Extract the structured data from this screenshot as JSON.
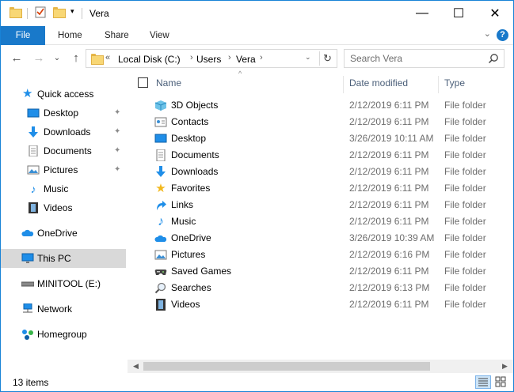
{
  "window": {
    "title": "Vera",
    "controls": {
      "minimize": "—",
      "maximize": "☐",
      "close": "✕"
    }
  },
  "ribbon": {
    "tabs": [
      "File",
      "Home",
      "Share",
      "View"
    ],
    "expand": "⌄",
    "help": "?"
  },
  "address": {
    "overflow": "«",
    "crumbs": [
      "Local Disk (C:)",
      "Users",
      "Vera"
    ],
    "separator": "›",
    "dropdown": "⌄",
    "refresh": "↻"
  },
  "search": {
    "placeholder": "Search Vera"
  },
  "nav_buttons": {
    "back": "←",
    "forward": "→",
    "recent": "⌄",
    "up": "↑"
  },
  "navigation": {
    "pin_glyph": "✦",
    "quick_access": {
      "label": "Quick access",
      "items": [
        {
          "label": "Desktop",
          "icon": "desktop-icon",
          "pinned": true
        },
        {
          "label": "Downloads",
          "icon": "downloads-icon",
          "pinned": true
        },
        {
          "label": "Documents",
          "icon": "documents-icon",
          "pinned": true
        },
        {
          "label": "Pictures",
          "icon": "pictures-icon",
          "pinned": true
        },
        {
          "label": "Music",
          "icon": "music-icon",
          "pinned": false
        },
        {
          "label": "Videos",
          "icon": "videos-icon",
          "pinned": false
        }
      ]
    },
    "onedrive": "OneDrive",
    "this_pc": "This PC",
    "minitool": "MINITOOL (E:)",
    "network": "Network",
    "homegroup": "Homegroup"
  },
  "columns": {
    "name": "Name",
    "date": "Date modified",
    "type": "Type",
    "sort_glyph": "^"
  },
  "files": [
    {
      "name": "3D Objects",
      "date": "2/12/2019 6:11 PM",
      "type": "File folder",
      "icon": "3d-objects-icon"
    },
    {
      "name": "Contacts",
      "date": "2/12/2019 6:11 PM",
      "type": "File folder",
      "icon": "contacts-icon"
    },
    {
      "name": "Desktop",
      "date": "3/26/2019 10:11 AM",
      "type": "File folder",
      "icon": "desktop-icon"
    },
    {
      "name": "Documents",
      "date": "2/12/2019 6:11 PM",
      "type": "File folder",
      "icon": "documents-icon"
    },
    {
      "name": "Downloads",
      "date": "2/12/2019 6:11 PM",
      "type": "File folder",
      "icon": "downloads-icon"
    },
    {
      "name": "Favorites",
      "date": "2/12/2019 6:11 PM",
      "type": "File folder",
      "icon": "favorites-icon"
    },
    {
      "name": "Links",
      "date": "2/12/2019 6:11 PM",
      "type": "File folder",
      "icon": "links-icon"
    },
    {
      "name": "Music",
      "date": "2/12/2019 6:11 PM",
      "type": "File folder",
      "icon": "music-icon"
    },
    {
      "name": "OneDrive",
      "date": "3/26/2019 10:39 AM",
      "type": "File folder",
      "icon": "onedrive-icon"
    },
    {
      "name": "Pictures",
      "date": "2/12/2019 6:16 PM",
      "type": "File folder",
      "icon": "pictures-icon"
    },
    {
      "name": "Saved Games",
      "date": "2/12/2019 6:11 PM",
      "type": "File folder",
      "icon": "saved-games-icon"
    },
    {
      "name": "Searches",
      "date": "2/12/2019 6:13 PM",
      "type": "File folder",
      "icon": "searches-icon"
    },
    {
      "name": "Videos",
      "date": "2/12/2019 6:11 PM",
      "type": "File folder",
      "icon": "videos-icon"
    }
  ],
  "scrollbar": {
    "left_arrow": "◀",
    "right_arrow": "▶"
  },
  "status": {
    "item_count": "13 items"
  },
  "colors": {
    "accent": "#1979ca",
    "selection": "#d9d9d9",
    "header_text": "#4c607a",
    "secondary_text": "#6d6d6d"
  }
}
